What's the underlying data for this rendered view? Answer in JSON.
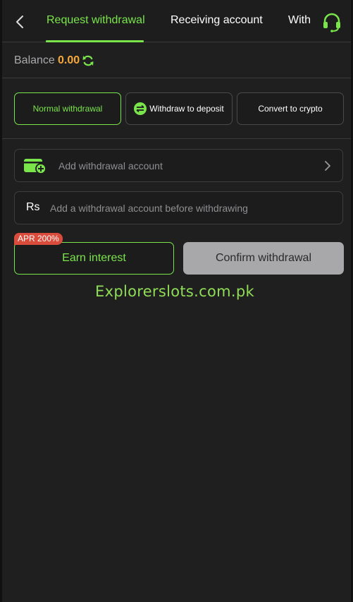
{
  "header": {
    "tabs": [
      {
        "label": "Request withdrawal",
        "active": true
      },
      {
        "label": "Receiving account",
        "active": false
      },
      {
        "label": "With",
        "active": false
      }
    ],
    "icons": {
      "back": "chevron-left-icon",
      "support": "headset-icon"
    }
  },
  "balance": {
    "label": "Balance",
    "value": "0.00",
    "refresh_icon": "refresh-icon"
  },
  "methods": [
    {
      "label": "Normal withdrawal",
      "active": true
    },
    {
      "label": "Withdraw to deposit",
      "active": false,
      "icon": "swap-icon"
    },
    {
      "label": "Convert to crypto",
      "active": false
    }
  ],
  "account": {
    "add_label": "Add withdrawal account",
    "icon": "wallet-add-icon"
  },
  "amount": {
    "currency_symbol": "Rs",
    "placeholder": "Add a withdrawal account before withdrawing",
    "value": ""
  },
  "actions": {
    "apr_badge": "APR 200%",
    "earn_label": "Earn interest",
    "confirm_label": "Confirm withdrawal"
  },
  "watermark": "Explorerslots.com.pk",
  "colors": {
    "accent": "#7ae54a",
    "balance": "#f6a93a",
    "badge": "#d94b3b",
    "background": "#1f1f20",
    "disabled_button": "#a8a8aa"
  }
}
